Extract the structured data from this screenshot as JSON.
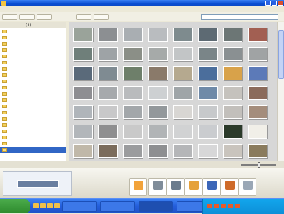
{
  "window": {
    "title": ""
  },
  "menubar": {
    "items": [
      "",
      "",
      "",
      "",
      "",
      "",
      "",
      "",
      ""
    ]
  },
  "search": {
    "placeholder": ""
  },
  "sidebar": {
    "header": "",
    "count": "(1)",
    "folders": [
      "",
      "",
      "",
      "",
      "",
      "",
      "",
      "",
      "",
      "",
      "",
      "",
      "",
      "",
      "",
      "",
      "",
      "",
      "",
      ""
    ]
  },
  "thumbnails": {
    "colors": [
      "#9aa39a",
      "#8c8f92",
      "#a9aeb2",
      "#b9bcbf",
      "#7e8b8e",
      "#5d6a73",
      "#6c7675",
      "#a25f52",
      "#6f7f7a",
      "#9ea3a6",
      "#8b8f87",
      "#a6aaa9",
      "#c2c5c6",
      "#7a8588",
      "#8a9092",
      "#a0a3a4",
      "#5a6a7a",
      "#7f8b92",
      "#6e7f6a",
      "#8a7a6a",
      "#b5a98f",
      "#4b6e9c",
      "#d8a24a",
      "#5c7ab8",
      "#8e8e92",
      "#a6a9ac",
      "#b9bbbd",
      "#cdd0d2",
      "#9fa5a8",
      "#6f8aa8",
      "#c5c2bd",
      "#8b6b5b",
      "#b0b5ba",
      "#c8c8c9",
      "#a3a7aa",
      "#93989b",
      "#d8d6d3",
      "#c7c9cb",
      "#c2bfbb",
      "#a48d7c",
      "#b2b6ba",
      "#8f8f90",
      "#c9c9c9",
      "#b1b4b6",
      "#d1d2d3",
      "#cacccf",
      "#2b3a2a",
      "#f1efe8",
      "#c0b8a9",
      "#7b6c5c",
      "#9b9c9e",
      "#8e8f91",
      "#b5b6b8",
      "#d7d7d8",
      "#c9c4bd",
      "#8a7b5d"
    ]
  },
  "statusbar": {
    "text": ""
  },
  "tray": {
    "buttons": [
      "",
      "",
      "",
      "",
      "",
      "",
      ""
    ]
  },
  "taskbar": {
    "start_label": "",
    "tasks": [
      "",
      "",
      "",
      "",
      ""
    ],
    "clock": ""
  }
}
